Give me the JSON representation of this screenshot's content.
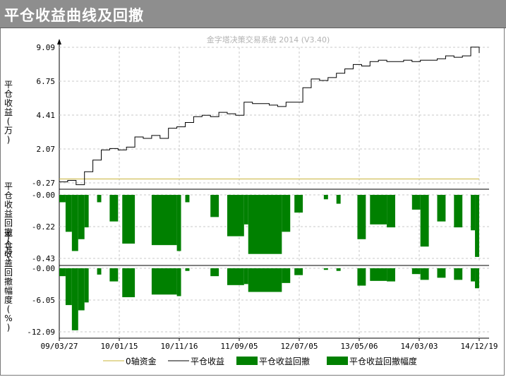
{
  "window": {
    "title": "平仓收益曲线及回撤"
  },
  "chart_data": {
    "type": "line",
    "subtitle": "金字塔决策交易系统 2014 (V3.40)",
    "x_labels": [
      "09/03/27",
      "10/01/15",
      "10/11/16",
      "11/09/05",
      "12/07/05",
      "13/05/06",
      "14/03/03",
      "14/12/19"
    ],
    "legend": [
      {
        "name": "0轴资金",
        "color": "#c9b43a",
        "kind": "line"
      },
      {
        "name": "平仓收益",
        "color": "#000000",
        "kind": "line"
      },
      {
        "name": "平仓收益回撤",
        "color": "#008000",
        "kind": "bar"
      },
      {
        "name": "平仓收益回撤幅度",
        "color": "#008000",
        "kind": "bar"
      }
    ],
    "panels": [
      {
        "name": "profit",
        "ylabel": "平仓收益(万)",
        "yticks": [
          "9.09",
          "6.75",
          "4.41",
          "2.07",
          "-0.27"
        ],
        "ylim": [
          -0.27,
          9.09
        ],
        "zero_line": 0,
        "series": [
          {
            "name": "平仓收益",
            "color": "#000000",
            "x": [
              0,
              0.02,
              0.04,
              0.06,
              0.08,
              0.1,
              0.12,
              0.14,
              0.16,
              0.18,
              0.2,
              0.22,
              0.24,
              0.26,
              0.28,
              0.3,
              0.32,
              0.34,
              0.36,
              0.38,
              0.4,
              0.42,
              0.44,
              0.46,
              0.48,
              0.5,
              0.52,
              0.54,
              0.56,
              0.58,
              0.6,
              0.62,
              0.64,
              0.66,
              0.68,
              0.7,
              0.72,
              0.74,
              0.76,
              0.78,
              0.8,
              0.82,
              0.84,
              0.86,
              0.88,
              0.9,
              0.92,
              0.94,
              0.96,
              0.98,
              1.0
            ],
            "values": [
              -0.2,
              -0.1,
              -0.4,
              0.5,
              1.3,
              2.0,
              2.1,
              2.0,
              2.2,
              2.9,
              2.8,
              3.0,
              2.8,
              3.5,
              3.6,
              3.9,
              4.3,
              4.4,
              4.3,
              4.6,
              4.5,
              4.4,
              5.3,
              5.2,
              5.2,
              5.1,
              5.0,
              5.3,
              5.3,
              6.3,
              6.9,
              6.8,
              7.0,
              7.3,
              7.6,
              7.9,
              7.8,
              8.1,
              8.2,
              8.1,
              8.1,
              8.2,
              8.1,
              8.2,
              8.2,
              8.3,
              8.5,
              8.4,
              8.5,
              9.1,
              8.7
            ]
          }
        ]
      },
      {
        "name": "drawdown",
        "ylabel": "平仓收益回撤(万)",
        "yticks": [
          "-0.00",
          "-0.22",
          "-0.43"
        ],
        "ylim": [
          -0.43,
          0
        ],
        "series": [
          {
            "name": "平仓收益回撤",
            "color": "#008000",
            "bars": [
              [
                0.0,
                0.015,
                -0.05
              ],
              [
                0.015,
                0.03,
                -0.25
              ],
              [
                0.03,
                0.045,
                -0.38
              ],
              [
                0.045,
                0.06,
                -0.3
              ],
              [
                0.06,
                0.07,
                -0.22
              ],
              [
                0.09,
                0.1,
                -0.05
              ],
              [
                0.12,
                0.14,
                -0.18
              ],
              [
                0.15,
                0.18,
                -0.33
              ],
              [
                0.22,
                0.28,
                -0.34
              ],
              [
                0.28,
                0.29,
                -0.38
              ],
              [
                0.3,
                0.31,
                -0.05
              ],
              [
                0.36,
                0.38,
                -0.15
              ],
              [
                0.4,
                0.44,
                -0.28
              ],
              [
                0.44,
                0.45,
                -0.2
              ],
              [
                0.45,
                0.53,
                -0.4
              ],
              [
                0.53,
                0.55,
                -0.25
              ],
              [
                0.56,
                0.58,
                -0.12
              ],
              [
                0.63,
                0.64,
                -0.03
              ],
              [
                0.66,
                0.67,
                -0.06
              ],
              [
                0.71,
                0.73,
                -0.3
              ],
              [
                0.74,
                0.78,
                -0.2
              ],
              [
                0.78,
                0.8,
                -0.22
              ],
              [
                0.84,
                0.86,
                -0.1
              ],
              [
                0.86,
                0.88,
                -0.35
              ],
              [
                0.9,
                0.92,
                -0.18
              ],
              [
                0.94,
                0.96,
                -0.22
              ],
              [
                0.98,
                0.99,
                -0.24
              ],
              [
                0.99,
                1.0,
                -0.42
              ]
            ]
          }
        ]
      },
      {
        "name": "drawdown_pct",
        "ylabel": "平仓收益回撤幅度(%)",
        "yticks": [
          "-0.00",
          "-6.05",
          "-12.09"
        ],
        "ylim": [
          -12.09,
          0
        ],
        "series": [
          {
            "name": "平仓收益回撤幅度",
            "color": "#008000",
            "bars": [
              [
                0.0,
                0.015,
                -1.5
              ],
              [
                0.015,
                0.03,
                -7.0
              ],
              [
                0.03,
                0.045,
                -11.8
              ],
              [
                0.045,
                0.06,
                -8.0
              ],
              [
                0.06,
                0.07,
                -6.5
              ],
              [
                0.09,
                0.1,
                -1.2
              ],
              [
                0.12,
                0.14,
                -2.5
              ],
              [
                0.15,
                0.18,
                -5.5
              ],
              [
                0.22,
                0.28,
                -5.0
              ],
              [
                0.28,
                0.29,
                -5.3
              ],
              [
                0.3,
                0.31,
                -0.5
              ],
              [
                0.36,
                0.38,
                -1.5
              ],
              [
                0.4,
                0.44,
                -3.2
              ],
              [
                0.44,
                0.45,
                -3.0
              ],
              [
                0.45,
                0.53,
                -4.5
              ],
              [
                0.53,
                0.55,
                -2.8
              ],
              [
                0.56,
                0.58,
                -1.3
              ],
              [
                0.63,
                0.64,
                -0.3
              ],
              [
                0.66,
                0.67,
                -0.5
              ],
              [
                0.71,
                0.73,
                -3.3
              ],
              [
                0.74,
                0.78,
                -2.4
              ],
              [
                0.78,
                0.8,
                -2.5
              ],
              [
                0.84,
                0.86,
                -1.1
              ],
              [
                0.86,
                0.88,
                -2.2
              ],
              [
                0.9,
                0.92,
                -1.8
              ],
              [
                0.94,
                0.96,
                -2.2
              ],
              [
                0.98,
                0.99,
                -2.5
              ],
              [
                0.99,
                1.0,
                -3.8
              ]
            ]
          }
        ]
      }
    ]
  }
}
